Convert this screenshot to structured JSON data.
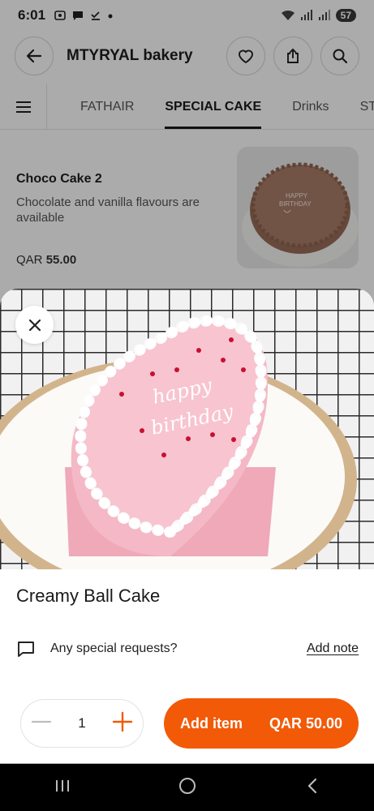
{
  "status_bar": {
    "time": "6:01",
    "battery": "57"
  },
  "header": {
    "title": "MTYRYAL bakery"
  },
  "tabs": [
    {
      "label": "FATHAIR",
      "active": false
    },
    {
      "label": "SPECIAL CAKE",
      "active": true
    },
    {
      "label": "Drinks",
      "active": false
    },
    {
      "label": "ST",
      "active": false
    }
  ],
  "product": {
    "name": "Choco Cake 2",
    "description": "Chocolate and vanilla flavours are available",
    "currency": "QAR",
    "price": "55.00",
    "image_text": [
      "HAPPY",
      "BIRTHDAY"
    ]
  },
  "item_sheet": {
    "title": "Creamy Ball Cake",
    "image_text": [
      "happy",
      "birthday"
    ],
    "special_request_label": "Any special requests?",
    "add_note_label": "Add note",
    "quantity": "1",
    "add_button_label": "Add item",
    "add_button_price": "QAR 50.00"
  },
  "colors": {
    "accent": "#f25a08",
    "cake_pink": "#f2b8c6",
    "choco": "#a47a63"
  }
}
